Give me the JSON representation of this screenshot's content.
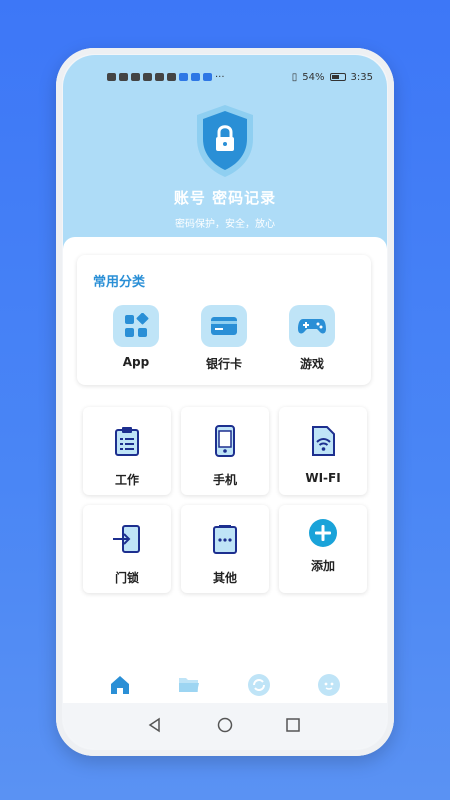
{
  "statusbar": {
    "battery": "54%",
    "time": "3:35",
    "more": "···"
  },
  "header": {
    "title": "账号 密码记录",
    "subtitle": "密码保护，安全，放心"
  },
  "categories": {
    "title": "常用分类",
    "items": [
      {
        "label": "App",
        "icon": "apps-icon"
      },
      {
        "label": "银行卡",
        "icon": "bank-card-icon"
      },
      {
        "label": "游戏",
        "icon": "gamepad-icon"
      }
    ]
  },
  "tiles": [
    {
      "label": "工作",
      "icon": "clipboard-icon"
    },
    {
      "label": "手机",
      "icon": "phone-icon"
    },
    {
      "label": "WI-FI",
      "icon": "wifi-icon"
    },
    {
      "label": "门锁",
      "icon": "door-enter-icon"
    },
    {
      "label": "其他",
      "icon": "other-icon"
    },
    {
      "label": "添加",
      "icon": "add-icon"
    }
  ],
  "nav": {
    "items": [
      "home-icon",
      "folder-icon",
      "sync-icon",
      "profile-icon"
    ],
    "active_index": 0
  },
  "colors": {
    "accent": "#2a8fd6",
    "hero_bg": "#aedcf7",
    "icon_dark": "#1d2f8f",
    "page_bg": "#3d77f7"
  }
}
